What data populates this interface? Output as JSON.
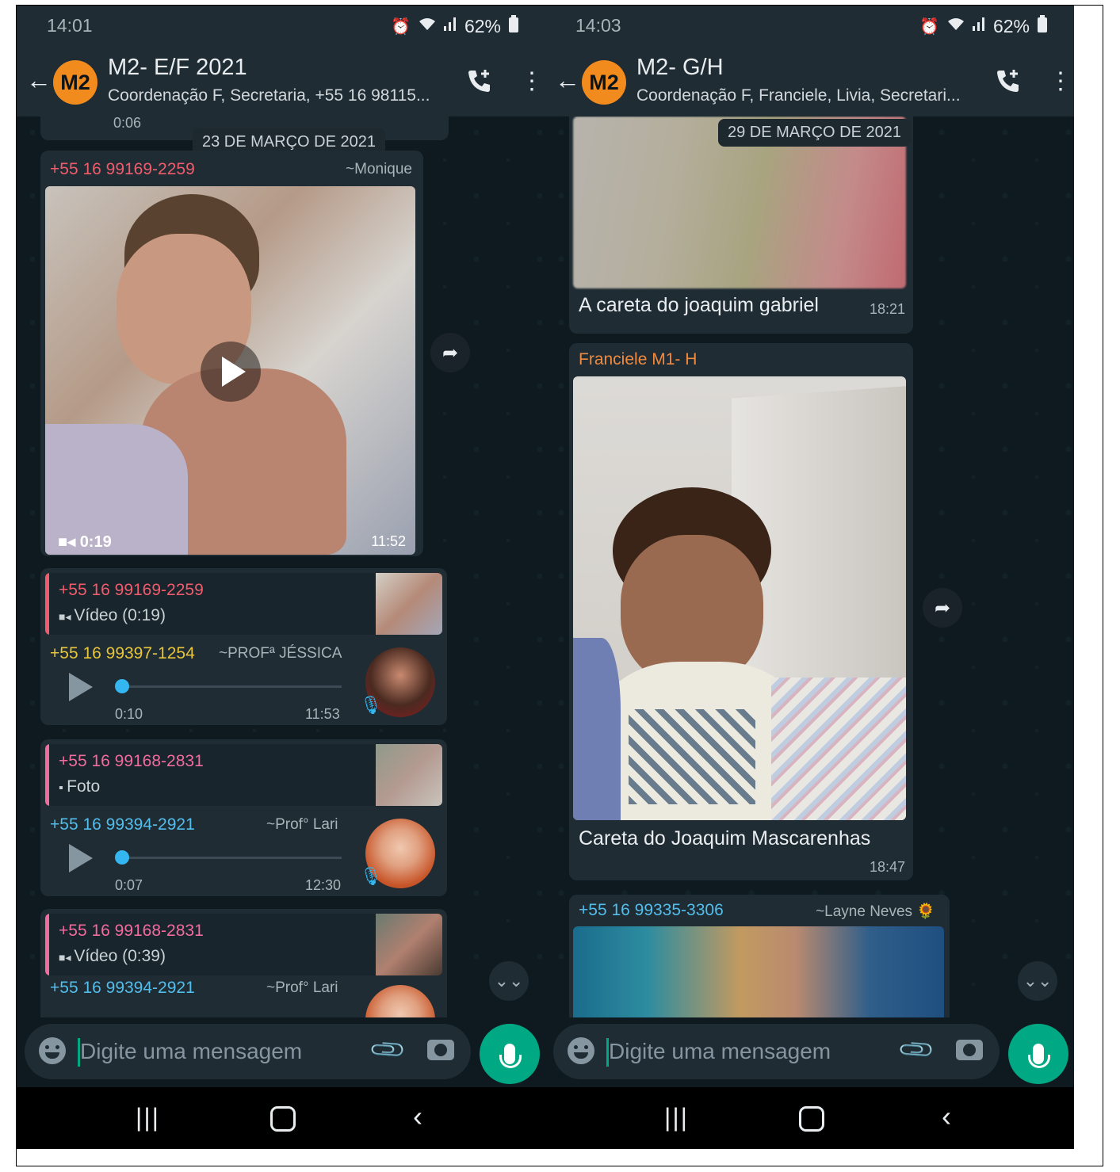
{
  "left": {
    "status": {
      "time": "14:01",
      "battery": "62%"
    },
    "header": {
      "avatar": "M2",
      "title": "M2- E/F 2021",
      "subtitle": "Coordenação F, Secretaria, +55 16 98115..."
    },
    "chat": {
      "top_partial_time": "0:06",
      "date_pill": "23 DE MARÇO DE 2021",
      "video_message": {
        "sender": "+55 16 99169-2259",
        "alias": "~Monique",
        "duration": "0:19",
        "time": "11:52"
      },
      "reply1": {
        "quote_sender": "+55 16 99169-2259",
        "quote_type": "Vídeo (0:19)",
        "sender": "+55 16 99397-1254",
        "alias": "~PROFª JÉSSICA",
        "voice_duration": "0:10",
        "time": "11:53"
      },
      "reply2": {
        "quote_sender": "+55 16 99168-2831",
        "quote_type": "Foto",
        "sender": "+55 16 99394-2921",
        "alias": "~Prof° Lari",
        "voice_duration": "0:07",
        "time": "12:30"
      },
      "reply3": {
        "quote_sender": "+55 16 99168-2831",
        "quote_type": "Vídeo (0:39)",
        "sender": "+55 16 99394-2921",
        "alias": "~Prof° Lari"
      }
    },
    "input": {
      "placeholder": "Digite uma mensagem"
    }
  },
  "right": {
    "status": {
      "time": "14:03",
      "battery": "62%"
    },
    "header": {
      "avatar": "M2",
      "title": "M2- G/H",
      "subtitle": "Coordenação F, Franciele, Livia, Secretari..."
    },
    "chat": {
      "date_pill": "29 DE MARÇO DE 2021",
      "msg1": {
        "caption": "A careta do joaquim gabriel",
        "time": "18:21"
      },
      "msg2": {
        "sender": "Franciele M1- H",
        "caption": "Careta do Joaquim Mascarenhas",
        "time": "18:47"
      },
      "msg3": {
        "sender": "+55 16 99335-3306",
        "alias": "~Layne Neves 🌻"
      }
    },
    "input": {
      "placeholder": "Digite uma mensagem"
    }
  },
  "colors": {
    "sender_red": "#f15c6d",
    "sender_yellow": "#e8c53a",
    "sender_blue": "#53bdeb",
    "sender_pink": "#f26b9d",
    "sender_orange": "#f08a3e",
    "accent": "#00a884"
  },
  "icons": [
    "back-arrow-icon",
    "add-call-icon",
    "more-vert-icon",
    "play-icon",
    "video-camera-icon",
    "photo-icon",
    "mic-icon",
    "forward-icon",
    "scroll-down-icon",
    "emoji-icon",
    "attach-icon",
    "camera-icon",
    "alarm-icon",
    "wifi-icon",
    "signal-icon",
    "battery-icon"
  ]
}
